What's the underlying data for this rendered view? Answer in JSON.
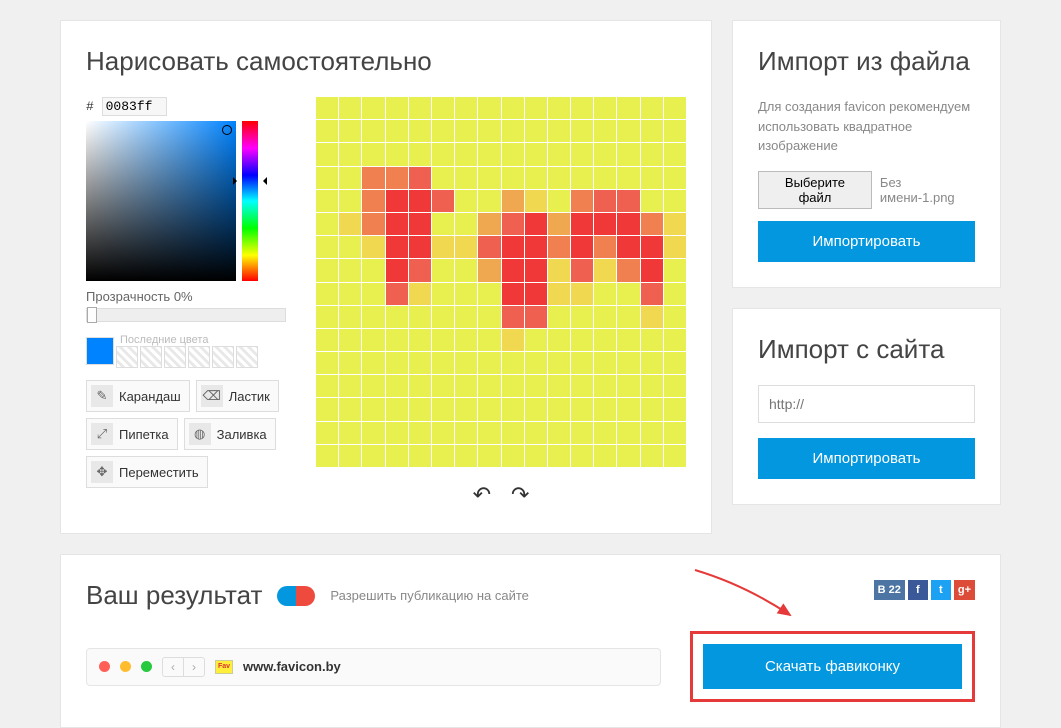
{
  "draw": {
    "title": "Нарисовать самостоятельно",
    "hash": "#",
    "hex": "0083ff",
    "opacity_label": "Прозрачность 0%",
    "recent_label": "Последние цвета",
    "tools": {
      "pencil": "Карандаш",
      "eraser": "Ластик",
      "pipette": "Пипетка",
      "fill": "Заливка",
      "move": "Переместить"
    },
    "grid_size": 16,
    "pixels": [
      [
        0,
        0,
        0,
        0,
        0,
        0,
        0,
        0,
        0,
        0,
        0,
        0,
        0,
        0,
        0,
        0
      ],
      [
        0,
        0,
        0,
        0,
        0,
        0,
        0,
        0,
        0,
        0,
        0,
        0,
        0,
        0,
        0,
        0
      ],
      [
        0,
        0,
        0,
        0,
        0,
        0,
        0,
        0,
        0,
        0,
        0,
        0,
        0,
        0,
        0,
        0
      ],
      [
        0,
        0,
        3,
        3,
        4,
        0,
        0,
        0,
        0,
        0,
        0,
        0,
        0,
        0,
        0,
        0
      ],
      [
        0,
        0,
        3,
        5,
        5,
        4,
        0,
        0,
        2,
        1,
        0,
        3,
        4,
        4,
        0,
        0
      ],
      [
        0,
        1,
        3,
        5,
        5,
        0,
        0,
        2,
        4,
        5,
        2,
        5,
        5,
        5,
        3,
        1
      ],
      [
        0,
        0,
        1,
        5,
        5,
        1,
        1,
        4,
        5,
        5,
        3,
        5,
        3,
        5,
        5,
        1
      ],
      [
        0,
        0,
        0,
        5,
        4,
        0,
        0,
        2,
        5,
        5,
        1,
        4,
        1,
        3,
        5,
        0
      ],
      [
        0,
        0,
        0,
        4,
        1,
        0,
        0,
        0,
        5,
        5,
        1,
        1,
        0,
        0,
        4,
        0
      ],
      [
        0,
        0,
        0,
        0,
        0,
        0,
        0,
        0,
        4,
        4,
        0,
        0,
        0,
        0,
        1,
        0
      ],
      [
        0,
        0,
        0,
        0,
        0,
        0,
        0,
        0,
        1,
        0,
        0,
        0,
        0,
        0,
        0,
        0
      ],
      [
        0,
        0,
        0,
        0,
        0,
        0,
        0,
        0,
        0,
        0,
        0,
        0,
        0,
        0,
        0,
        0
      ],
      [
        0,
        0,
        0,
        0,
        0,
        0,
        0,
        0,
        0,
        0,
        0,
        0,
        0,
        0,
        0,
        0
      ],
      [
        0,
        0,
        0,
        0,
        0,
        0,
        0,
        0,
        0,
        0,
        0,
        0,
        0,
        0,
        0,
        0
      ],
      [
        0,
        0,
        0,
        0,
        0,
        0,
        0,
        0,
        0,
        0,
        0,
        0,
        0,
        0,
        0,
        0
      ],
      [
        0,
        0,
        0,
        0,
        0,
        0,
        0,
        0,
        0,
        0,
        0,
        0,
        0,
        0,
        0,
        0
      ]
    ],
    "palette": [
      "#e8f050",
      "#f0d850",
      "#f0a850",
      "#f08050",
      "#f06050",
      "#f03838"
    ]
  },
  "import_file": {
    "title": "Импорт из файла",
    "hint": "Для создания favicon рекомендуем использовать квадратное изображение",
    "choose_btn": "Выберите файл",
    "filename": "Без имени-1.png",
    "import_btn": "Импортировать"
  },
  "import_site": {
    "title": "Импорт с сайта",
    "placeholder": "http://",
    "import_btn": "Импортировать"
  },
  "result": {
    "title": "Ваш результат",
    "toggle_label": "Разрешить публикацию на сайте",
    "vk_count": "В 22",
    "fb": "f",
    "tw": "t",
    "gp": "g+",
    "browser_url": "www.favicon.by",
    "download_btn": "Скачать фавиконку",
    "fav_text": "Fav"
  }
}
